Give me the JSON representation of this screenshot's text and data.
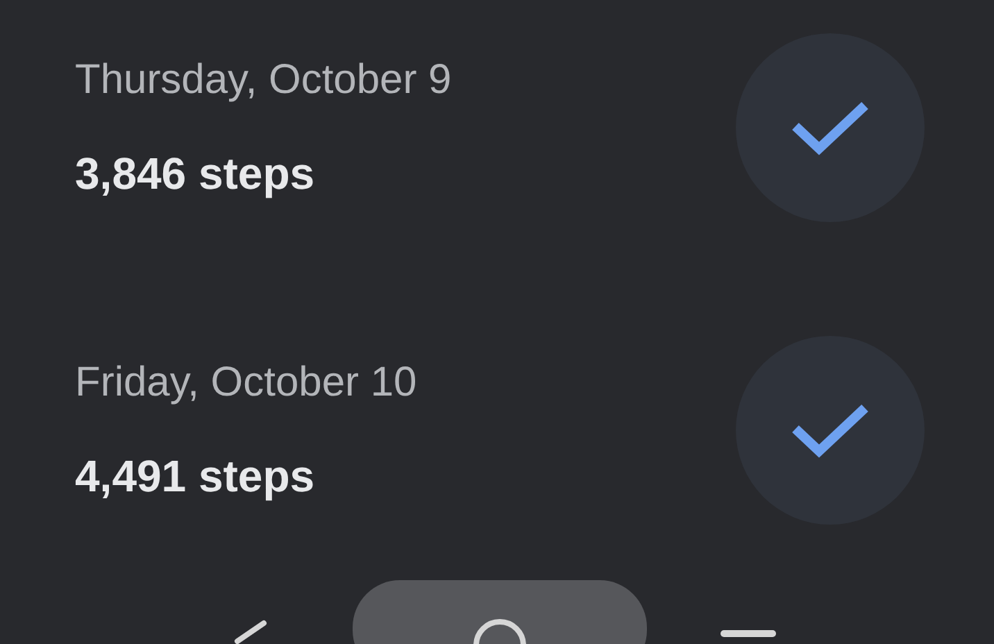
{
  "days": [
    {
      "date": "Thursday, October 9",
      "steps": "3,846 steps",
      "checked": true
    },
    {
      "date": "Friday, October 10",
      "steps": "4,491 steps",
      "checked": true
    }
  ]
}
